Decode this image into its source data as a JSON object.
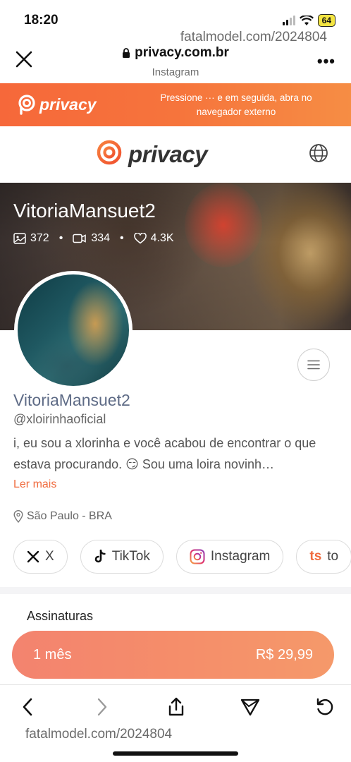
{
  "status": {
    "time": "18:20",
    "battery": "64"
  },
  "watermark": "fatalmodel.com/2024804",
  "browser": {
    "url": "privacy.com.br",
    "source": "Instagram",
    "more_label": "•••"
  },
  "banner": {
    "logo_text": "privacy",
    "message": "Pressione ··· e em seguida, abra no navegador externo"
  },
  "site": {
    "logo_text": "privacy"
  },
  "cover": {
    "name": "VitoriaMansuet2",
    "stats": {
      "photos": "372",
      "videos": "334",
      "likes": "4.3K"
    }
  },
  "profile": {
    "name": "VitoriaMansuet2",
    "handle": "@xloirinhaoficial",
    "bio": "i, eu sou a xlorinha e você acabou de encontrar o que estava procurando. 😏 Sou uma loira novinh…",
    "read_more": "Ler mais",
    "location": "São Paulo - BRA"
  },
  "socials": [
    {
      "icon": "x-icon",
      "label": "X"
    },
    {
      "icon": "tiktok-icon",
      "label": "TikTok"
    },
    {
      "icon": "instagram-icon",
      "label": "Instagram"
    },
    {
      "icon": "ts",
      "label": "to"
    }
  ],
  "subscriptions": {
    "title": "Assinaturas",
    "plans": [
      {
        "period": "1 mês",
        "price": "R$ 29,99"
      }
    ]
  },
  "colors": {
    "brand": "#f6683a",
    "accent_text": "#f06b3e",
    "name_color": "#5e6b86"
  }
}
